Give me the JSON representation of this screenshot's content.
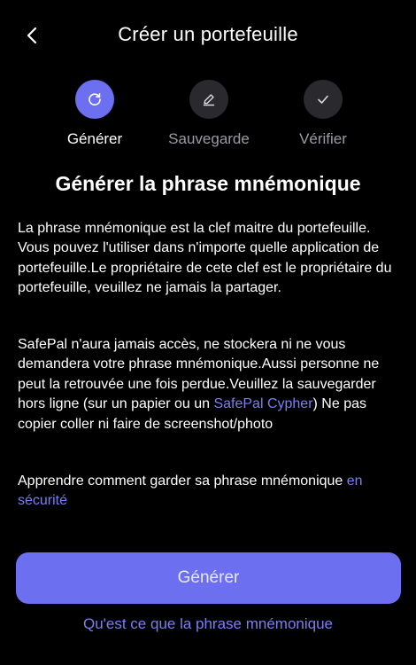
{
  "header": {
    "title": "Créer un portefeuille",
    "back_icon": "chevron-left-icon"
  },
  "stepper": {
    "steps": [
      {
        "label": "Générer",
        "icon": "refresh-icon",
        "active": true
      },
      {
        "label": "Sauvegarde",
        "icon": "pencil-icon",
        "active": false
      },
      {
        "label": "Vérifier",
        "icon": "check-icon",
        "active": false
      }
    ]
  },
  "main": {
    "title": "Générer la phrase mnémonique",
    "paragraph1": "La phrase mnémonique est la clef maitre du portefeuille. Vous pouvez l'utiliser dans n'importe quelle application de portefeuille.Le propriétaire de cete clef est le propriétaire du portefeuille, veuillez ne jamais la partager.",
    "paragraph2_before": "SafePal n'aura jamais accès, ne stockera ni ne vous demandera votre phrase mnémonique.Aussi personne ne peut la retrouvée une fois perdue.Veuillez la sauvegarder hors ligne (sur un papier ou un ",
    "paragraph2_link": "SafePal Cypher",
    "paragraph2_after": ") Ne pas copier coller ni faire de screenshot/photo",
    "paragraph3_before": "Apprendre comment garder sa phrase mnémonique ",
    "paragraph3_link": "en sécurité"
  },
  "actions": {
    "primary_label": "Générer",
    "secondary_link": "Qu'est ce que la phrase mnémonique"
  },
  "colors": {
    "accent": "#6b6ff0",
    "link": "#7b7ff5",
    "background": "#000000",
    "inactive_circle": "#2a2a2e",
    "inactive_text": "#9b9ba5"
  }
}
